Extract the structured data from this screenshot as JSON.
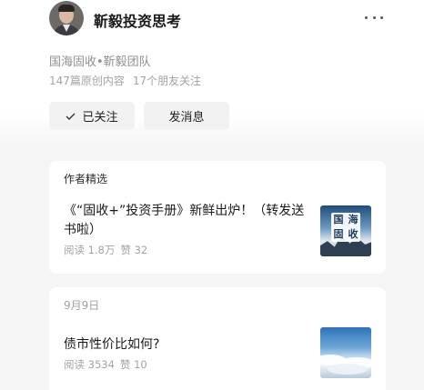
{
  "profile": {
    "account_name": "靳毅投资思考",
    "org": "国海固收•靳毅团队",
    "stats": {
      "articles": "147篇原创内容",
      "friends": "17个朋友关注"
    },
    "follow_label": "已关注",
    "message_label": "发消息"
  },
  "featured": {
    "label": "作者精选",
    "article": {
      "title": "《“固收+”投资手册》新鲜出炉！（转发送书啦）",
      "reads": "阅读 1.8万",
      "likes": "赞 32",
      "thumb_text": [
        "国",
        "海",
        "固",
        "收"
      ]
    }
  },
  "dated": {
    "date": "9月9日",
    "article": {
      "title": "债市性价比如何?",
      "reads": "阅读 3534",
      "likes": "赞 10"
    }
  },
  "icons": {
    "more": "more-dots-icon",
    "check": "check-icon"
  },
  "colors": {
    "page_bg": "#f5f5f5",
    "card_bg": "#ffffff",
    "button_bg": "#f2f2f2",
    "muted_text": "#a3a3a3"
  }
}
